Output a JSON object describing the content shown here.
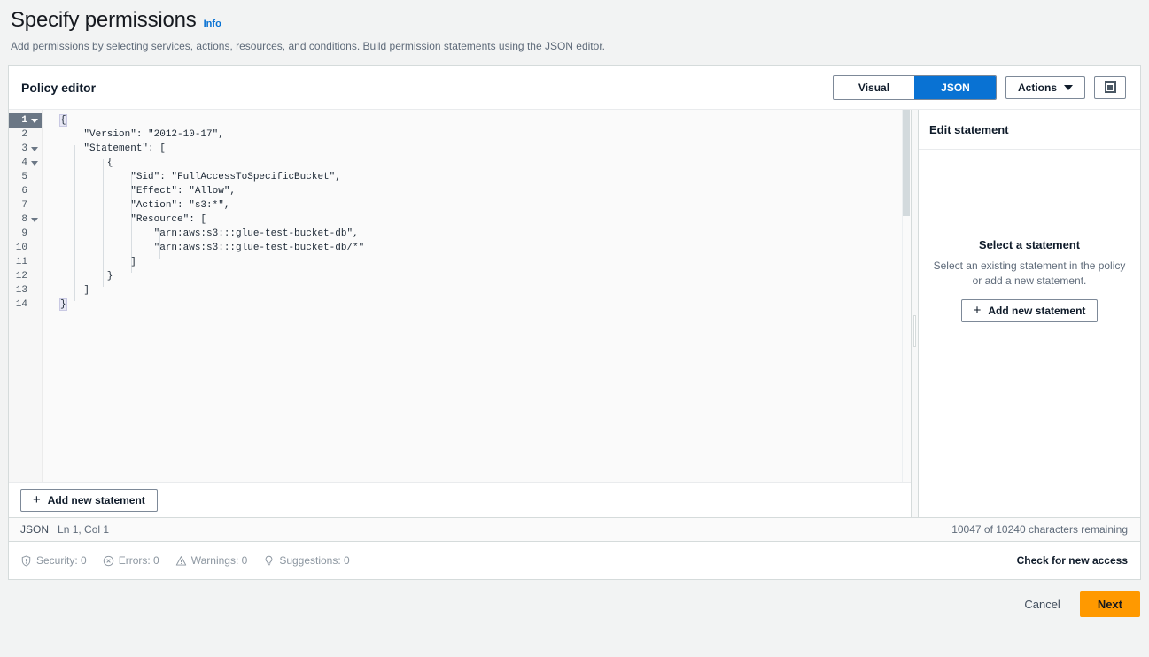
{
  "page": {
    "title": "Specify permissions",
    "info_label": "Info",
    "description": "Add permissions by selecting services, actions, resources, and conditions. Build permission statements using the JSON editor."
  },
  "container": {
    "title": "Policy editor",
    "view_toggle": {
      "options": [
        "Visual",
        "JSON"
      ],
      "selected": "JSON"
    },
    "actions_button": "Actions",
    "panel_toggle_icon": "split-panel-icon"
  },
  "editor": {
    "lines": [
      {
        "num": "1",
        "foldable": true,
        "active": true,
        "text": "{"
      },
      {
        "num": "2",
        "foldable": false,
        "active": false,
        "text": "    \"Version\": \"2012-10-17\","
      },
      {
        "num": "3",
        "foldable": true,
        "active": false,
        "text": "    \"Statement\": ["
      },
      {
        "num": "4",
        "foldable": true,
        "active": false,
        "text": "        {"
      },
      {
        "num": "5",
        "foldable": false,
        "active": false,
        "text": "            \"Sid\": \"FullAccessToSpecificBucket\","
      },
      {
        "num": "6",
        "foldable": false,
        "active": false,
        "text": "            \"Effect\": \"Allow\","
      },
      {
        "num": "7",
        "foldable": false,
        "active": false,
        "text": "            \"Action\": \"s3:*\","
      },
      {
        "num": "8",
        "foldable": true,
        "active": false,
        "text": "            \"Resource\": ["
      },
      {
        "num": "9",
        "foldable": false,
        "active": false,
        "text": "                \"arn:aws:s3:::glue-test-bucket-db\","
      },
      {
        "num": "10",
        "foldable": false,
        "active": false,
        "text": "                \"arn:aws:s3:::glue-test-bucket-db/*\""
      },
      {
        "num": "11",
        "foldable": false,
        "active": false,
        "text": "            ]"
      },
      {
        "num": "12",
        "foldable": false,
        "active": false,
        "text": "        }"
      },
      {
        "num": "13",
        "foldable": false,
        "active": false,
        "text": "    ]"
      },
      {
        "num": "14",
        "foldable": false,
        "active": false,
        "text": "}"
      }
    ],
    "add_statement_button": "Add new statement"
  },
  "side_panel": {
    "header": "Edit statement",
    "empty_title": "Select a statement",
    "empty_description": "Select an existing statement in the policy or add a new statement.",
    "add_statement_button": "Add new statement"
  },
  "status": {
    "language": "JSON",
    "cursor": "Ln 1, Col 1",
    "characters": "10047 of 10240 characters remaining"
  },
  "lint": {
    "items": [
      {
        "icon": "shield-icon",
        "label": "Security: 0"
      },
      {
        "icon": "error-icon",
        "label": "Errors: 0"
      },
      {
        "icon": "warning-icon",
        "label": "Warnings: 0"
      },
      {
        "icon": "lightbulb-icon",
        "label": "Suggestions: 0"
      }
    ],
    "check_access": "Check for new access"
  },
  "footer": {
    "cancel": "Cancel",
    "next": "Next"
  },
  "colors": {
    "accent_blue": "#0972d3",
    "primary_orange": "#ff9900",
    "text_dark": "#16191f",
    "text_muted": "#5f6b7a",
    "active_line_gutter": "#6b7785"
  }
}
